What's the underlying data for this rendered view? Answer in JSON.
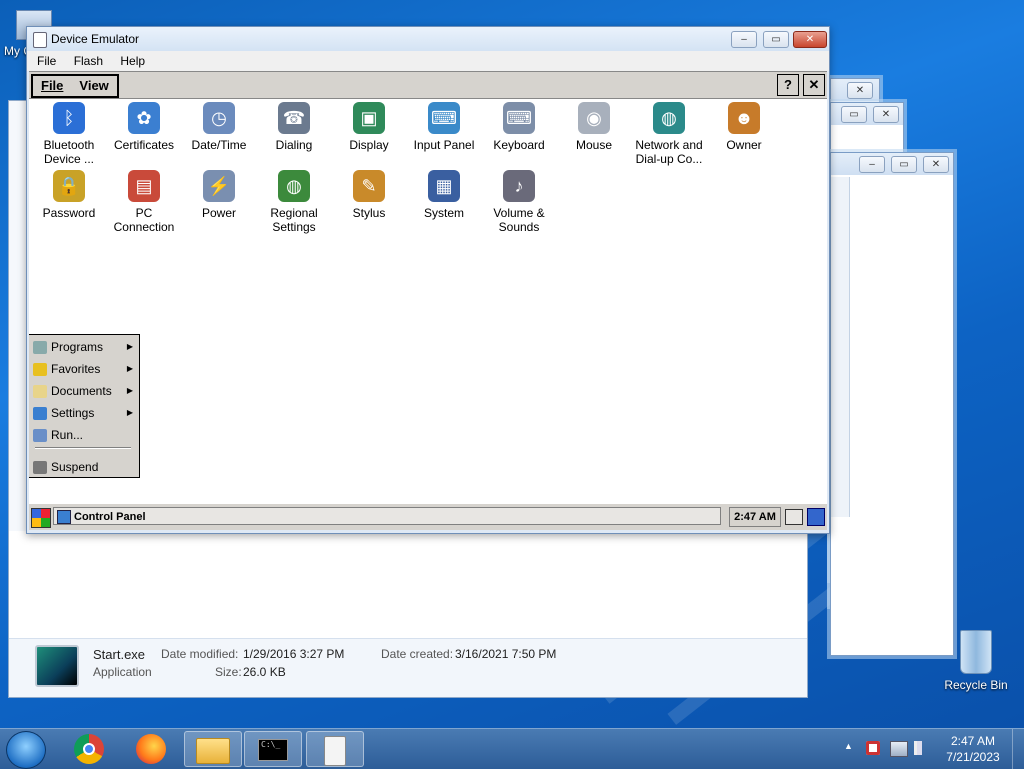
{
  "desktop": {
    "my_computer_label": "My C",
    "recycle_bin_label": "Recycle Bin"
  },
  "emulator": {
    "title": "Device Emulator",
    "menu": [
      "File",
      "Flash",
      "Help"
    ],
    "device_menu": [
      "File",
      "View"
    ],
    "help_button": "?",
    "close_button": "✕",
    "icons": [
      {
        "label": "Bluetooth\nDevice ...",
        "icon": "bluetooth-icon",
        "color": "#2b6fd6"
      },
      {
        "label": "Certificates",
        "icon": "certificates-icon",
        "color": "#3b7fd1"
      },
      {
        "label": "Date/Time",
        "icon": "clock-icon",
        "color": "#6b8bbd"
      },
      {
        "label": "Dialing",
        "icon": "phone-icon",
        "color": "#6b7a8f"
      },
      {
        "label": "Display",
        "icon": "display-icon",
        "color": "#2f8a5a"
      },
      {
        "label": "Input Panel",
        "icon": "input-panel-icon",
        "color": "#3a8ac9"
      },
      {
        "label": "Keyboard",
        "icon": "keyboard-icon",
        "color": "#7d8ea8"
      },
      {
        "label": "Mouse",
        "icon": "mouse-icon",
        "color": "#a8b0bc"
      },
      {
        "label": "Network and\nDial-up Co...",
        "icon": "network-icon",
        "color": "#2b8a8a"
      },
      {
        "label": "Owner",
        "icon": "owner-icon",
        "color": "#c77b2a"
      },
      {
        "label": "Password",
        "icon": "lock-icon",
        "color": "#c9a227"
      },
      {
        "label": "PC\nConnection",
        "icon": "pc-connection-icon",
        "color": "#c94a3a"
      },
      {
        "label": "Power",
        "icon": "power-icon",
        "color": "#7a8fb0"
      },
      {
        "label": "Regional\nSettings",
        "icon": "globe-icon",
        "color": "#3c8a3c"
      },
      {
        "label": "Stylus",
        "icon": "stylus-icon",
        "color": "#c98a2a"
      },
      {
        "label": "System",
        "icon": "system-icon",
        "color": "#3a5fa0"
      },
      {
        "label": "Volume &\nSounds",
        "icon": "speaker-icon",
        "color": "#6a6a7a"
      }
    ],
    "start_menu": [
      {
        "label": "Programs",
        "icon": "programs-icon",
        "submenu": true
      },
      {
        "label": "Favorites",
        "icon": "star-icon",
        "submenu": true
      },
      {
        "label": "Documents",
        "icon": "documents-icon",
        "submenu": true
      },
      {
        "label": "Settings",
        "icon": "settings-icon",
        "submenu": true
      },
      {
        "label": "Run...",
        "icon": "run-icon",
        "submenu": false
      },
      {
        "label": "Suspend",
        "icon": "suspend-icon",
        "submenu": false
      }
    ],
    "taskbar_item": "Control Panel",
    "device_clock": "2:47 AM"
  },
  "explorer_details": {
    "file_name": "Start.exe",
    "file_type": "Application",
    "date_modified_label": "Date modified:",
    "date_modified": "1/29/2016 3:27 PM",
    "size_label": "Size:",
    "size": "26.0 KB",
    "date_created_label": "Date created:",
    "date_created": "3/16/2021 7:50 PM"
  },
  "taskbar": {
    "time": "2:47 AM",
    "date": "7/21/2023",
    "cmd_label": "C:\\_",
    "show_hidden_icons": "▲"
  },
  "colors": {
    "win7_blue": "#1a7de0",
    "wince_gray": "#d6d3ce"
  }
}
